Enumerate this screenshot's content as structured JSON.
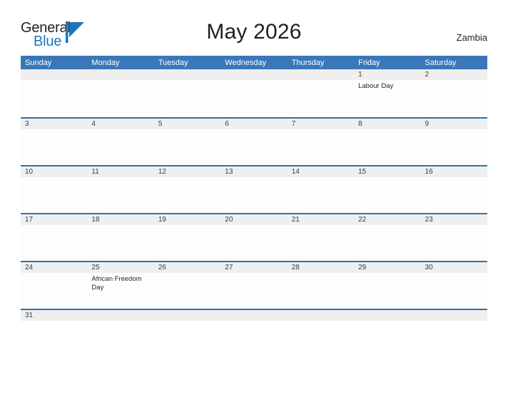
{
  "brand": {
    "name_part1": "General",
    "name_part2": "Blue",
    "mark": "triangle-logo-icon",
    "accent_color": "#1b75bb"
  },
  "header": {
    "title": "May 2026",
    "country": "Zambia"
  },
  "colors": {
    "header_blue": "#3a77b8",
    "row_line_blue": "#2e73ad",
    "day_band_gray": "#efefef",
    "text_dark": "#231f20"
  },
  "calendar": {
    "weekday_headers": [
      "Sunday",
      "Monday",
      "Tuesday",
      "Wednesday",
      "Thursday",
      "Friday",
      "Saturday"
    ],
    "weeks": [
      {
        "days": [
          {
            "num": "",
            "event": ""
          },
          {
            "num": "",
            "event": ""
          },
          {
            "num": "",
            "event": ""
          },
          {
            "num": "",
            "event": ""
          },
          {
            "num": "",
            "event": ""
          },
          {
            "num": "1",
            "event": "Labour Day"
          },
          {
            "num": "2",
            "event": ""
          }
        ]
      },
      {
        "days": [
          {
            "num": "3",
            "event": ""
          },
          {
            "num": "4",
            "event": ""
          },
          {
            "num": "5",
            "event": ""
          },
          {
            "num": "6",
            "event": ""
          },
          {
            "num": "7",
            "event": ""
          },
          {
            "num": "8",
            "event": ""
          },
          {
            "num": "9",
            "event": ""
          }
        ]
      },
      {
        "days": [
          {
            "num": "10",
            "event": ""
          },
          {
            "num": "11",
            "event": ""
          },
          {
            "num": "12",
            "event": ""
          },
          {
            "num": "13",
            "event": ""
          },
          {
            "num": "14",
            "event": ""
          },
          {
            "num": "15",
            "event": ""
          },
          {
            "num": "16",
            "event": ""
          }
        ]
      },
      {
        "days": [
          {
            "num": "17",
            "event": ""
          },
          {
            "num": "18",
            "event": ""
          },
          {
            "num": "19",
            "event": ""
          },
          {
            "num": "20",
            "event": ""
          },
          {
            "num": "21",
            "event": ""
          },
          {
            "num": "22",
            "event": ""
          },
          {
            "num": "23",
            "event": ""
          }
        ]
      },
      {
        "days": [
          {
            "num": "24",
            "event": ""
          },
          {
            "num": "25",
            "event": "African Freedom Day"
          },
          {
            "num": "26",
            "event": ""
          },
          {
            "num": "27",
            "event": ""
          },
          {
            "num": "28",
            "event": ""
          },
          {
            "num": "29",
            "event": ""
          },
          {
            "num": "30",
            "event": ""
          }
        ]
      },
      {
        "days": [
          {
            "num": "31",
            "event": ""
          },
          {
            "num": "",
            "event": ""
          },
          {
            "num": "",
            "event": ""
          },
          {
            "num": "",
            "event": ""
          },
          {
            "num": "",
            "event": ""
          },
          {
            "num": "",
            "event": ""
          },
          {
            "num": "",
            "event": ""
          }
        ]
      }
    ]
  }
}
